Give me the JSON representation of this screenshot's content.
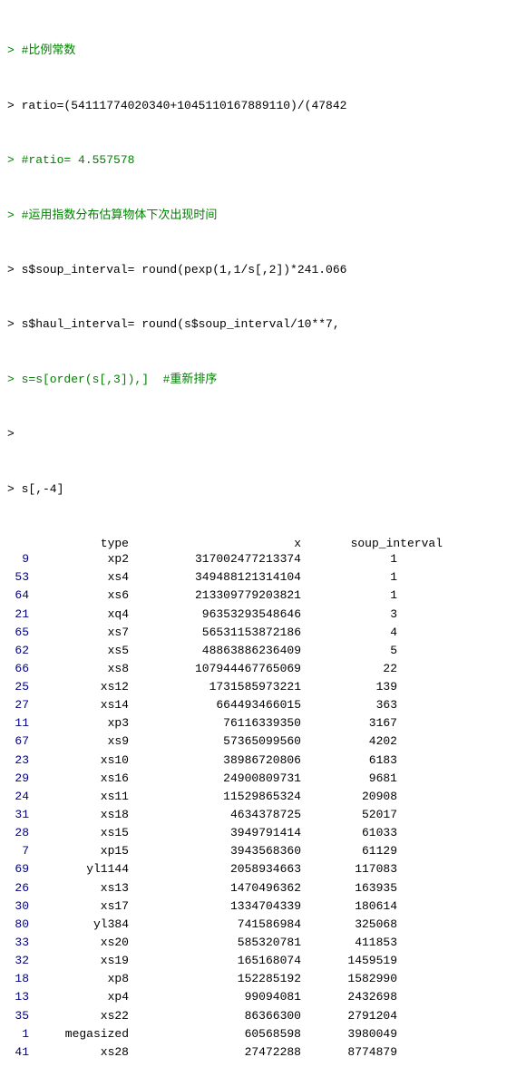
{
  "console": {
    "lines": [
      {
        "type": "comment",
        "text": "> #比例常数"
      },
      {
        "type": "prompt",
        "text": "> ratio=(54111774020340+1045110167889110)/(47842"
      },
      {
        "type": "comment",
        "text": "> #ratio= 4.557578"
      },
      {
        "type": "comment",
        "text": "> #运用指数分布估算物体下次出现时间"
      },
      {
        "type": "prompt",
        "text": "> s$soup_interval= round(pexp(1,1/s[,2])*241.066"
      },
      {
        "type": "prompt",
        "text": "> s$haul_interval= round(s$soup_interval/10**7,"
      },
      {
        "type": "comment",
        "text": "> s=s[order(s[,3]),]  #重新排序"
      },
      {
        "type": "empty",
        "text": ">"
      },
      {
        "type": "prompt",
        "text": "> s[,-4]"
      }
    ],
    "table": {
      "headers": [
        "",
        "type",
        "x",
        "soup_interval"
      ],
      "rows": [
        {
          "index": "9",
          "type": "xp2",
          "x": "317002477213374",
          "soup_interval": "1"
        },
        {
          "index": "53",
          "type": "xs4",
          "x": "349488121314104",
          "soup_interval": "1"
        },
        {
          "index": "64",
          "type": "xs6",
          "x": "213309779203821",
          "soup_interval": "1"
        },
        {
          "index": "21",
          "type": "xq4",
          "x": "96353293548646",
          "soup_interval": "3"
        },
        {
          "index": "65",
          "type": "xs7",
          "x": "56531153872186",
          "soup_interval": "4"
        },
        {
          "index": "62",
          "type": "xs5",
          "x": "48863886236409",
          "soup_interval": "5"
        },
        {
          "index": "66",
          "type": "xs8",
          "x": "107944467765069",
          "soup_interval": "22"
        },
        {
          "index": "25",
          "type": "xs12",
          "x": "1731585973221",
          "soup_interval": "139"
        },
        {
          "index": "27",
          "type": "xs14",
          "x": "664493466015",
          "soup_interval": "363"
        },
        {
          "index": "11",
          "type": "xp3",
          "x": "76116339350",
          "soup_interval": "3167"
        },
        {
          "index": "67",
          "type": "xs9",
          "x": "57365099560",
          "soup_interval": "4202"
        },
        {
          "index": "23",
          "type": "xs10",
          "x": "38986720806",
          "soup_interval": "6183"
        },
        {
          "index": "29",
          "type": "xs16",
          "x": "24900809731",
          "soup_interval": "9681"
        },
        {
          "index": "24",
          "type": "xs11",
          "x": "11529865324",
          "soup_interval": "20908"
        },
        {
          "index": "31",
          "type": "xs18",
          "x": "4634378725",
          "soup_interval": "52017"
        },
        {
          "index": "28",
          "type": "xs15",
          "x": "3949791414",
          "soup_interval": "61033"
        },
        {
          "index": "7",
          "type": "xp15",
          "x": "3943568360",
          "soup_interval": "61129"
        },
        {
          "index": "69",
          "type": "yl1144",
          "x": "2058934663",
          "soup_interval": "117083"
        },
        {
          "index": "26",
          "type": "xs13",
          "x": "1470496362",
          "soup_interval": "163935"
        },
        {
          "index": "30",
          "type": "xs17",
          "x": "1334704339",
          "soup_interval": "180614"
        },
        {
          "index": "80",
          "type": "yl384",
          "x": "741586984",
          "soup_interval": "325068"
        },
        {
          "index": "33",
          "type": "xs20",
          "x": "585320781",
          "soup_interval": "411853"
        },
        {
          "index": "32",
          "type": "xs19",
          "x": "165168074",
          "soup_interval": "1459519"
        },
        {
          "index": "18",
          "type": "xp8",
          "x": "152285192",
          "soup_interval": "1582990"
        },
        {
          "index": "13",
          "type": "xp4",
          "x": "99094081",
          "soup_interval": "2432698"
        },
        {
          "index": "35",
          "type": "xs22",
          "x": "86366300",
          "soup_interval": "2791204"
        },
        {
          "index": "1",
          "type": "megasized",
          "x": "60568598",
          "soup_interval": "3980049"
        },
        {
          "index": "41",
          "type": "xs28",
          "x": "27472288",
          "soup_interval": "8774879"
        }
      ]
    }
  }
}
